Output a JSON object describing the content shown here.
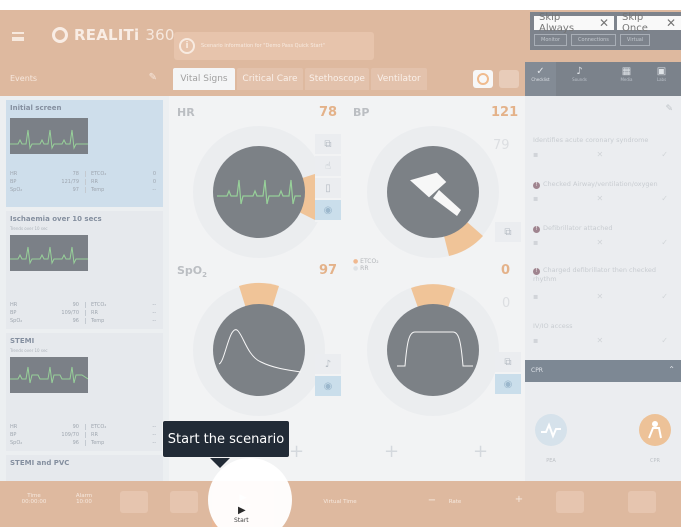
{
  "app": {
    "logo": "REALITi",
    "logo_suffix": "360",
    "info_text": "Scenario information for \"Demo Pass Quick Start\""
  },
  "skip": {
    "always_label": "Skip Always",
    "once_label": "Skip Once",
    "close": "✕",
    "subtabs": [
      "Monitor",
      "Connections",
      "Virtual"
    ]
  },
  "events": {
    "header": "Events",
    "items": [
      {
        "title": "Initial screen",
        "subtitle": "",
        "vitals": [
          [
            "HR",
            "78",
            "ETCO₂",
            "0"
          ],
          [
            "BP",
            "121/79",
            "RR",
            "0"
          ],
          [
            "SpO₂",
            "97",
            "Temp",
            "--"
          ]
        ]
      },
      {
        "title": "Ischaemia over 10 secs",
        "subtitle": "Trends over 10 sec",
        "vitals": [
          [
            "HR",
            "90",
            "ETCO₂",
            "--"
          ],
          [
            "BP",
            "109/70",
            "RR",
            "--"
          ],
          [
            "SpO₂",
            "96",
            "Temp",
            "--"
          ]
        ]
      },
      {
        "title": "STEMI",
        "subtitle": "Trends over 10 sec",
        "vitals": [
          [
            "HR",
            "90",
            "ETCO₂",
            "--"
          ],
          [
            "BP",
            "109/70",
            "RR",
            "--"
          ],
          [
            "SpO₂",
            "96",
            "Temp",
            "--"
          ]
        ]
      },
      {
        "title": "STEMI and PVC",
        "subtitle": "",
        "vitals": []
      }
    ]
  },
  "tabs": [
    "Vital Signs",
    "Critical Care",
    "Stethoscope",
    "Ventilator"
  ],
  "vitals": {
    "hr": {
      "label": "HR",
      "value": "78"
    },
    "bp": {
      "label": "BP",
      "sys": "121",
      "dia": "79"
    },
    "spo2": {
      "label": "SpO",
      "sub": "2",
      "value": "97"
    },
    "etco2": {
      "label": "ETCO₂",
      "rr": "RR",
      "value": "0",
      "value2": "0"
    }
  },
  "right_tabs": [
    {
      "icon": "✓",
      "label": "Checklist"
    },
    {
      "icon": "♪",
      "label": "Sounds"
    },
    {
      "icon": "▦",
      "label": "Media"
    },
    {
      "icon": "▣",
      "label": "Labs"
    }
  ],
  "checklist": {
    "items": [
      {
        "text": "Identifies acute coronary syndrome",
        "warn": false
      },
      {
        "text": "Checked Airway/ventilation/oxygen",
        "warn": true
      },
      {
        "text": "Defibrillator attached",
        "warn": true
      },
      {
        "text": "Charged defibrillator then checked rhythm",
        "warn": true
      },
      {
        "text": "IV/IO access",
        "warn": false
      }
    ],
    "cpr_header": "CPR",
    "pea_label": "PEA",
    "cpr_label": "CPR"
  },
  "bottom": {
    "time_label": "Time",
    "time_value": "00:00:00",
    "alarm_label": "Alarm",
    "alarm_value": "10:00",
    "start_label": "Start",
    "virtual_time": "Virtual Time",
    "rate": "Rate"
  },
  "tooltip": {
    "text": "Start the scenario"
  }
}
